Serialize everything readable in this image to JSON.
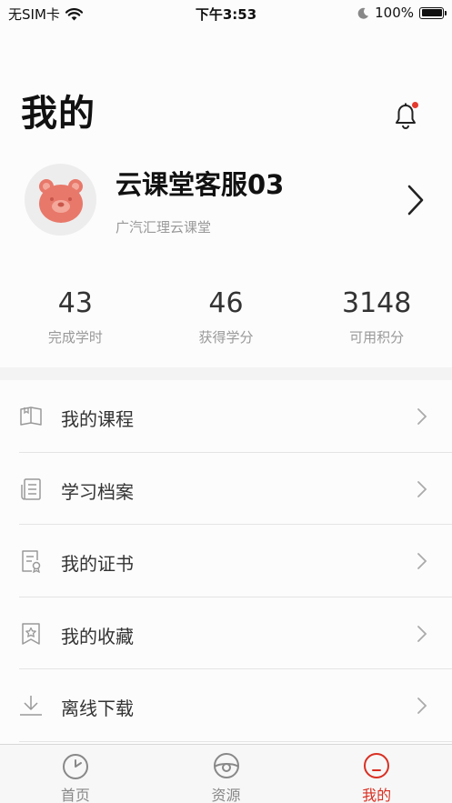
{
  "status_bar": {
    "carrier": "无SIM卡",
    "time": "下午3:53",
    "battery": "100%"
  },
  "header": {
    "title": "我的"
  },
  "profile": {
    "name": "云课堂客服03",
    "organization": "广汽汇理云课堂"
  },
  "stats": [
    {
      "value": "43",
      "label": "完成学时"
    },
    {
      "value": "46",
      "label": "获得学分"
    },
    {
      "value": "3148",
      "label": "可用积分"
    }
  ],
  "menu": [
    {
      "label": "我的课程",
      "icon": "book-icon"
    },
    {
      "label": "学习档案",
      "icon": "document-icon"
    },
    {
      "label": "我的证书",
      "icon": "certificate-icon"
    },
    {
      "label": "我的收藏",
      "icon": "bookmark-star-icon"
    },
    {
      "label": "离线下载",
      "icon": "download-icon"
    }
  ],
  "tabs": [
    {
      "label": "首页",
      "icon": "home-clock-icon",
      "active": false
    },
    {
      "label": "资源",
      "icon": "resources-icon",
      "active": false
    },
    {
      "label": "我的",
      "icon": "profile-icon",
      "active": true
    }
  ],
  "colors": {
    "accent": "#d92f22",
    "notification_dot": "#e53a2f"
  }
}
